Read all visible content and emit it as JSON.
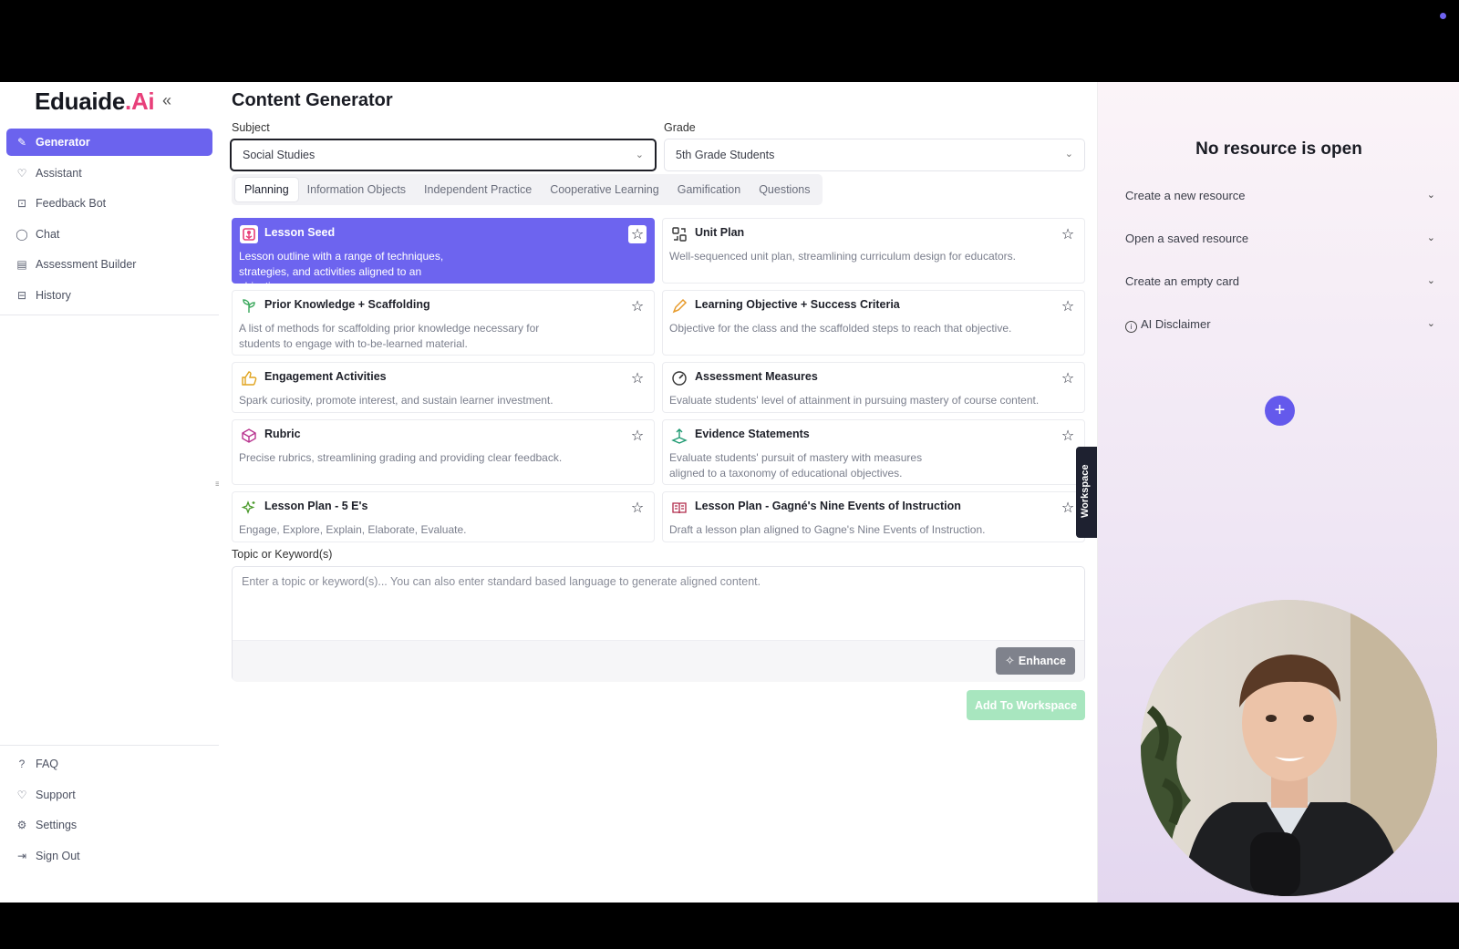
{
  "brand": {
    "name": "Eduaide",
    "accent": ".Ai"
  },
  "sidebar": {
    "collapse_icon": "double-chevron-left-icon",
    "items": [
      {
        "label": "Generator",
        "icon": "edit-icon",
        "active": true
      },
      {
        "label": "Assistant",
        "icon": "heart-icon"
      },
      {
        "label": "Feedback Bot",
        "icon": "bot-icon"
      },
      {
        "label": "Chat",
        "icon": "chat-icon"
      },
      {
        "label": "Assessment Builder",
        "icon": "clipboard-icon"
      },
      {
        "label": "History",
        "icon": "inbox-icon"
      }
    ],
    "bottom_items": [
      {
        "label": "FAQ",
        "icon": "question-icon"
      },
      {
        "label": "Support",
        "icon": "heart-icon"
      },
      {
        "label": "Settings",
        "icon": "gear-icon"
      },
      {
        "label": "Sign Out",
        "icon": "sign-out-icon"
      }
    ]
  },
  "main": {
    "title": "Content Generator",
    "subject": {
      "label": "Subject",
      "value": "Social Studies"
    },
    "grade": {
      "label": "Grade",
      "value": "5th Grade Students"
    },
    "tabs": [
      "Planning",
      "Information Objects",
      "Independent Practice",
      "Cooperative Learning",
      "Gamification",
      "Questions"
    ],
    "active_tab": "Planning",
    "cards": [
      {
        "title": "Lesson Seed",
        "desc": "Lesson outline with a range of techniques, strategies, and activities aligned to an objective.",
        "icon": "seed-icon",
        "active": true
      },
      {
        "title": "Unit Plan",
        "desc": "Well-sequenced unit plan, streamlining curriculum design for educators.",
        "icon": "unit-plan-icon"
      },
      {
        "title": "Prior Knowledge + Scaffolding",
        "desc": "A list of methods for scaffolding prior knowledge necessary for students to engage with to-be-learned material.",
        "icon": "scaffold-icon"
      },
      {
        "title": "Learning Objective + Success Criteria",
        "desc": "Objective for the class and the scaffolded steps to reach that objective.",
        "icon": "pencil-icon"
      },
      {
        "title": "Engagement Activities",
        "desc": "Spark curiosity, promote interest, and sustain learner investment.",
        "icon": "thumbs-up-icon"
      },
      {
        "title": "Assessment Measures",
        "desc": "Evaluate students' level of attainment in pursuing mastery of course content.",
        "icon": "gauge-icon"
      },
      {
        "title": "Rubric",
        "desc": "Precise rubrics, streamlining grading and providing clear feedback.",
        "icon": "cube-icon"
      },
      {
        "title": "Evidence Statements",
        "desc": "Evaluate students' pursuit of mastery with measures aligned to a taxonomy of educational objectives.",
        "icon": "evidence-icon"
      },
      {
        "title": "Lesson Plan - 5 E's",
        "desc": "Engage, Explore, Explain, Elaborate, Evaluate.",
        "icon": "sparkles-icon"
      },
      {
        "title": "Lesson Plan - Gagné's Nine Events of Instruction",
        "desc": "Draft a lesson plan aligned to Gagne's Nine Events of Instruction.",
        "icon": "book-icon"
      }
    ],
    "topic": {
      "label": "Topic or Keyword(s)",
      "placeholder": "Enter a topic or keyword(s)... You can also enter standard based language to generate aligned content.",
      "value": ""
    },
    "enhance_label": "Enhance",
    "add_label": "Add To Workspace",
    "workspace_tab_label": "Workspace"
  },
  "right_panel": {
    "title": "No resource is open",
    "accordions": [
      "Create a new resource",
      "Open a saved resource",
      "Create an empty card",
      "AI Disclaimer"
    ]
  },
  "colors": {
    "accent": "#6b63ee",
    "brand_pink": "#e8407a",
    "add_button": "#a8e6bf"
  }
}
